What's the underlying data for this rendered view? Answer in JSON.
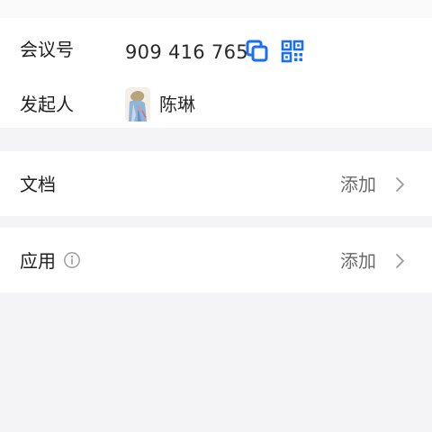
{
  "meeting": {
    "number_label": "会议号",
    "number_value": "909 416 765",
    "initiator_label": "发起人",
    "initiator_name": "陈琳"
  },
  "docs": {
    "label": "文档",
    "action": "添加"
  },
  "apps": {
    "label": "应用",
    "action": "添加"
  },
  "icons": {
    "copy": "copy-icon",
    "qr": "qr-code-icon",
    "info": "info-icon",
    "chevron": "chevron-right-icon"
  },
  "colors": {
    "accent": "#1a6ef5",
    "text_primary": "#1f1f1f",
    "text_secondary": "#6a6a6a",
    "background": "#f4f4f6",
    "card": "#ffffff"
  }
}
